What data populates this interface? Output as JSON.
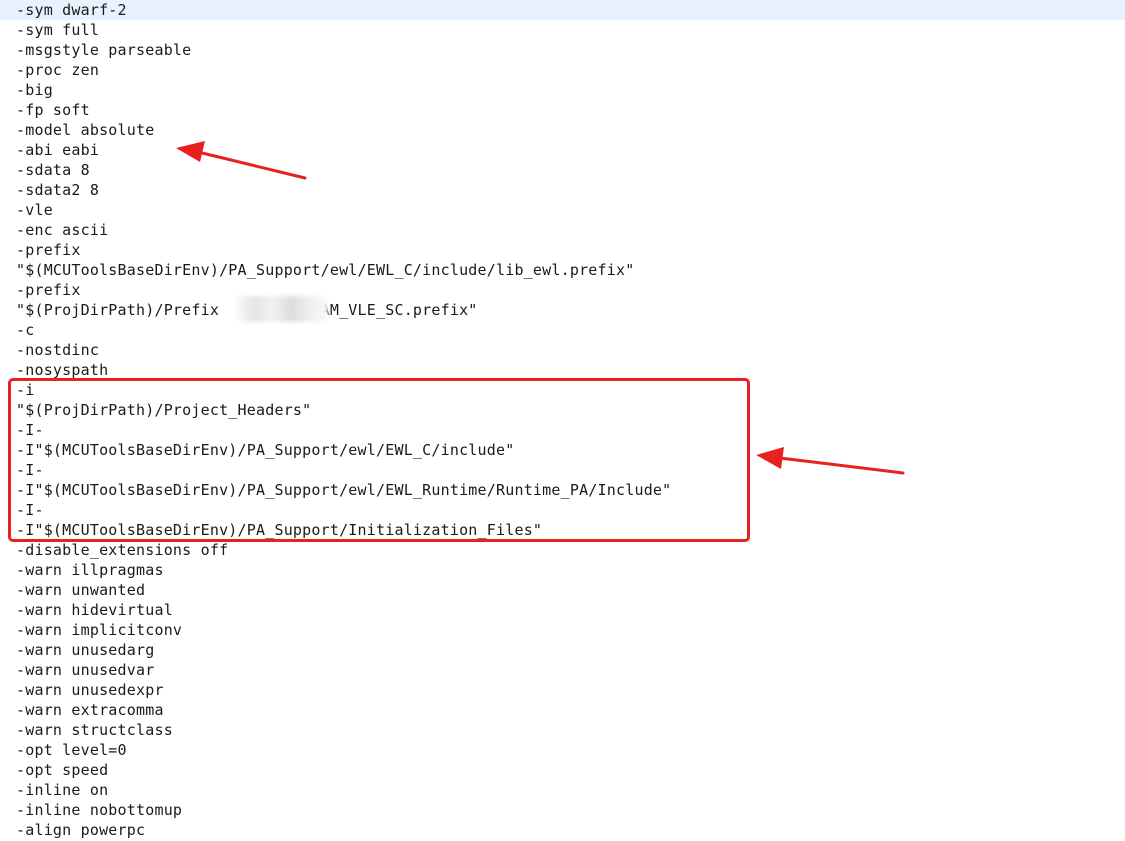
{
  "editor": {
    "lines": [
      "-sym dwarf-2",
      "-sym full",
      "-msgstyle parseable",
      "-proc zen",
      "-big",
      "-fp soft",
      "-model absolute",
      "-abi eabi",
      "-sdata 8",
      "-sdata2 8",
      "-vle",
      "-enc ascii",
      "-prefix",
      "\"$(MCUToolsBaseDirEnv)/PA_Support/ewl/EWL_C/include/lib_ewl.prefix\"",
      "-prefix",
      "\"$(ProjDirPath)/Prefix         _RAM_VLE_SC.prefix\"",
      "-c",
      "-nostdinc",
      "-nosyspath",
      "-i",
      "\"$(ProjDirPath)/Project_Headers\"",
      "-I-",
      "-I\"$(MCUToolsBaseDirEnv)/PA_Support/ewl/EWL_C/include\"",
      "-I-",
      "-I\"$(MCUToolsBaseDirEnv)/PA_Support/ewl/EWL_Runtime/Runtime_PA/Include\"",
      "-I-",
      "-I\"$(MCUToolsBaseDirEnv)/PA_Support/Initialization_Files\"",
      "-disable_extensions off",
      "-warn illpragmas",
      "-warn unwanted",
      "-warn hidevirtual",
      "-warn implicitconv",
      "-warn unusedarg",
      "-warn unusedvar",
      "-warn unusedexpr",
      "-warn extracomma",
      "-warn structclass",
      "-opt level=0",
      "-opt speed",
      "-inline on",
      "-inline nobottomup",
      "-align powerpc"
    ],
    "current_line_index": 0
  },
  "annotations": {
    "color": "#e8211f",
    "highlight_first_line": 19,
    "highlight_last_line": 26,
    "arrow_targets": [
      "-abi eabi",
      "highlighted include path block"
    ]
  }
}
